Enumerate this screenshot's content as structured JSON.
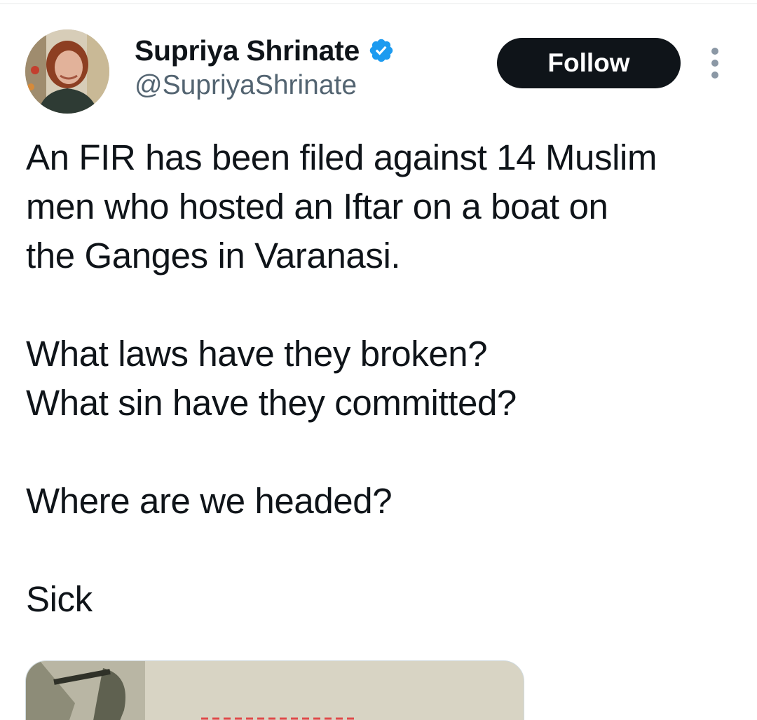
{
  "author": {
    "display_name": "Supriya Shrinate",
    "handle": "@SupriyaShrinate",
    "verified": true
  },
  "actions": {
    "follow_label": "Follow",
    "more_icon": "more-vertical-icon"
  },
  "tweet": {
    "text_lines": [
      "An FIR has been filed against 14 Muslim",
      "men who hosted an Iftar on a boat on",
      "the Ganges in Varanasi.",
      "What laws have they broken?",
      "What sin have they committed?",
      "Where are we headed?",
      "Sick"
    ]
  },
  "colors": {
    "verified_badge": "#1d9bf0",
    "follow_button_bg": "#0f1419",
    "follow_button_text": "#ffffff",
    "handle_text": "#536471",
    "media_caption_text": "#e04a4a"
  }
}
